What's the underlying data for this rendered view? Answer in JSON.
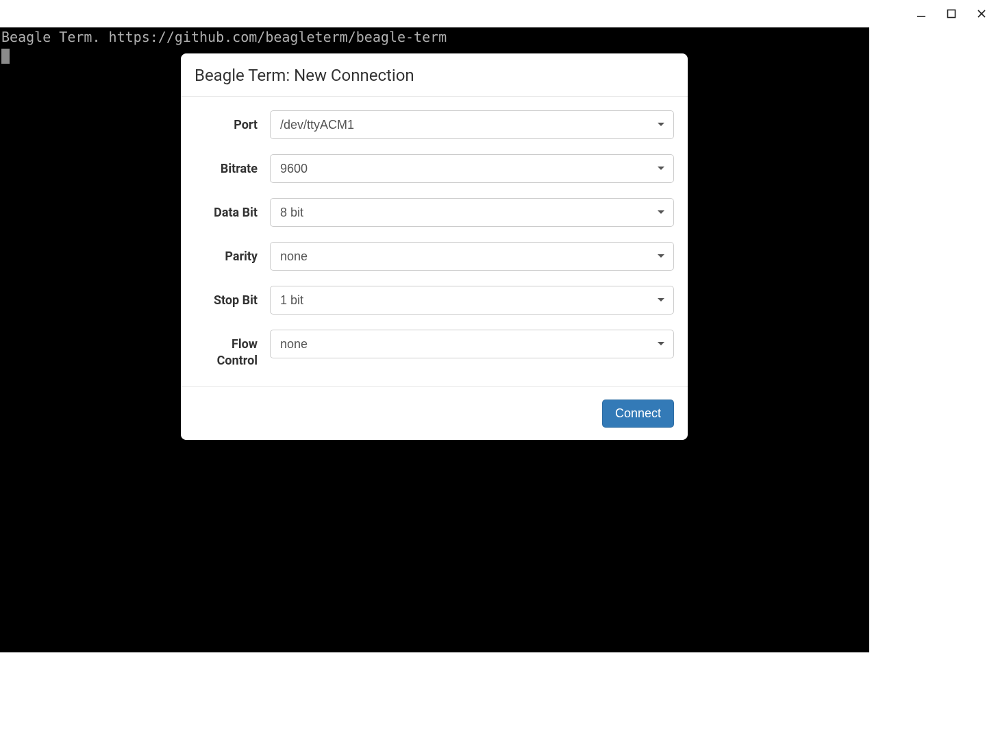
{
  "window": {
    "minimize_icon": "minimize",
    "maximize_icon": "maximize",
    "close_icon": "close"
  },
  "terminal": {
    "banner": "Beagle Term. https://github.com/beagleterm/beagle-term"
  },
  "modal": {
    "title": "Beagle Term: New Connection",
    "fields": {
      "port": {
        "label": "Port",
        "value": "/dev/ttyACM1"
      },
      "bitrate": {
        "label": "Bitrate",
        "value": "9600"
      },
      "databit": {
        "label": "Data Bit",
        "value": "8 bit"
      },
      "parity": {
        "label": "Parity",
        "value": "none"
      },
      "stopbit": {
        "label": "Stop Bit",
        "value": "1 bit"
      },
      "flowcontrol": {
        "label": "Flow Control",
        "value": "none"
      }
    },
    "connect_label": "Connect"
  }
}
